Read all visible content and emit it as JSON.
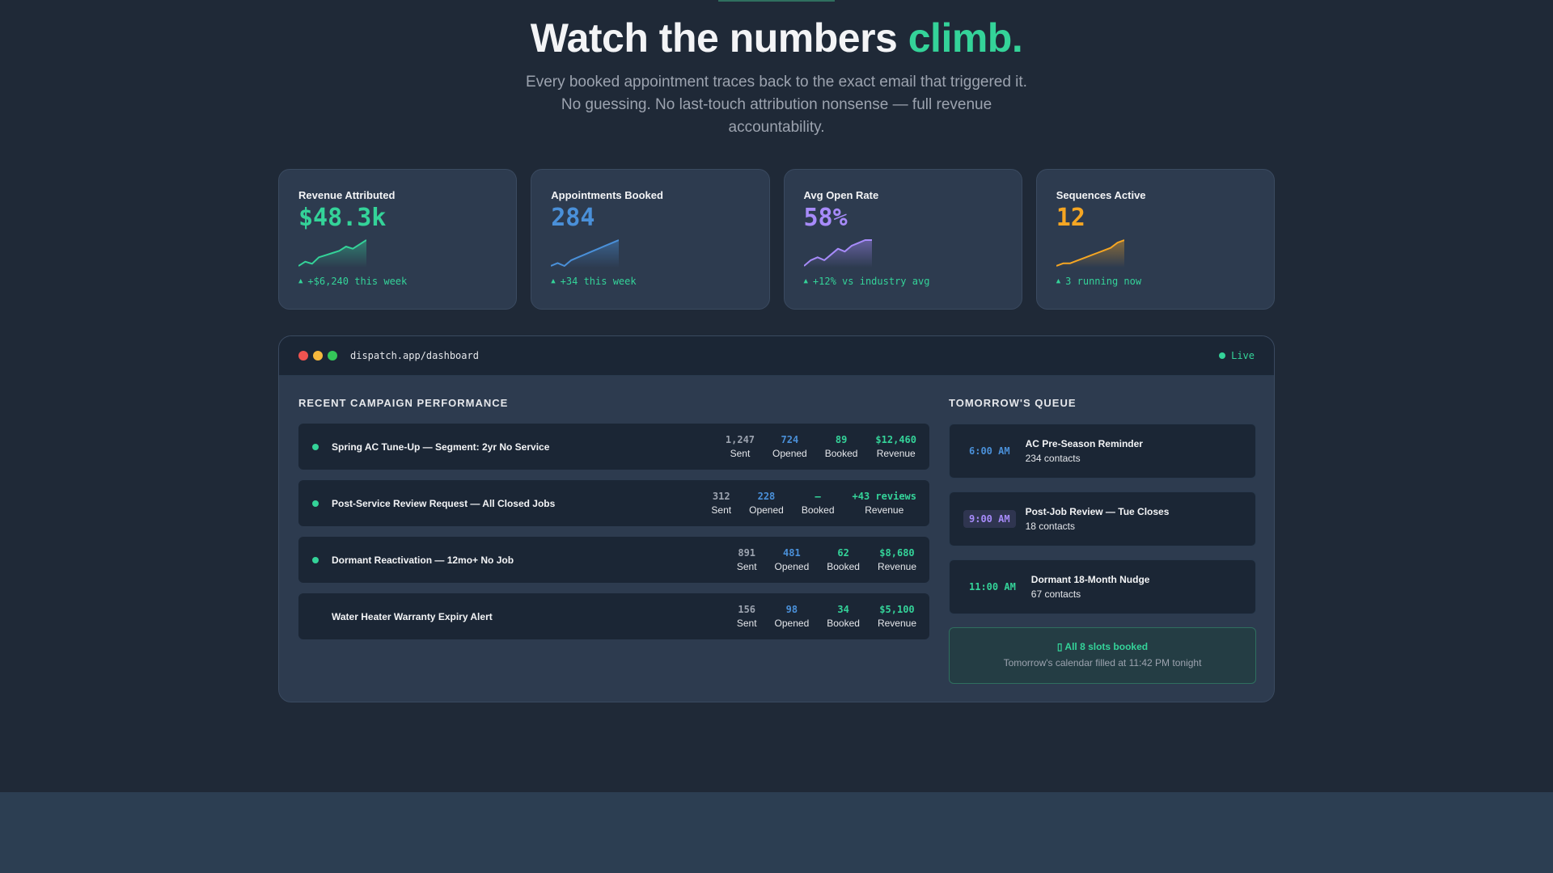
{
  "hero": {
    "title_main": "Watch the numbers ",
    "title_accent": "climb.",
    "subtitle": "Every booked appointment traces back to the exact email that triggered it. No guessing. No last-touch attribution nonsense — full revenue accountability."
  },
  "stats": [
    {
      "label": "Revenue Attributed",
      "value": "$48.3k",
      "trend": "+$6,240 this week",
      "color": "#34d399",
      "spark": [
        2,
        4,
        3,
        6,
        7,
        8,
        9,
        11,
        10,
        12,
        14
      ]
    },
    {
      "label": "Appointments Booked",
      "value": "284",
      "trend": "+34 this week",
      "color": "#4a90d9",
      "spark": [
        2,
        3,
        2,
        4,
        5,
        6,
        7,
        8,
        9,
        10,
        11
      ]
    },
    {
      "label": "Avg Open Rate",
      "value": "58%",
      "trend": "+12% vs industry avg",
      "color": "#a78bfa",
      "spark": [
        2,
        4,
        5,
        4,
        6,
        8,
        7,
        9,
        10,
        11,
        11
      ]
    },
    {
      "label": "Sequences Active",
      "value": "12",
      "trend": "3 running now",
      "color": "#f5a623",
      "spark": [
        2,
        3,
        3,
        4,
        5,
        6,
        7,
        8,
        9,
        11,
        12
      ]
    }
  ],
  "window": {
    "url": "dispatch.app/dashboard",
    "live_label": "Live"
  },
  "campaigns": {
    "title": "RECENT CAMPAIGN PERFORMANCE",
    "metric_labels": {
      "sent": "Sent",
      "opened": "Opened",
      "booked": "Booked",
      "revenue": "Revenue"
    },
    "rows": [
      {
        "name": "Spring AC Tune-Up — Segment: 2yr No Service",
        "active": true,
        "sent": "1,247",
        "opened": "724",
        "booked": "89",
        "revenue": "$12,460"
      },
      {
        "name": "Post-Service Review Request — All Closed Jobs",
        "active": true,
        "sent": "312",
        "opened": "228",
        "booked": "—",
        "revenue": "+43 reviews"
      },
      {
        "name": "Dormant Reactivation — 12mo+ No Job",
        "active": true,
        "sent": "891",
        "opened": "481",
        "booked": "62",
        "revenue": "$8,680"
      },
      {
        "name": "Water Heater Warranty Expiry Alert",
        "active": false,
        "sent": "156",
        "opened": "98",
        "booked": "34",
        "revenue": "$5,100"
      }
    ]
  },
  "queue": {
    "title": "TOMORROW'S QUEUE",
    "items": [
      {
        "time": "6:00 AM",
        "title": "AC Pre-Season Reminder",
        "sub": "234 contacts",
        "time_color": "#4a90d9",
        "time_bg": "transparent"
      },
      {
        "time": "9:00 AM",
        "title": "Post-Job Review — Tue Closes",
        "sub": "18 contacts",
        "time_color": "#a78bfa",
        "time_bg": "#2f3550"
      },
      {
        "time": "11:00 AM",
        "title": "Dormant 18-Month Nudge",
        "sub": "67 contacts",
        "time_color": "#34d399",
        "time_bg": "transparent"
      }
    ],
    "done_title": "▯ All 8 slots booked",
    "done_sub": "Tomorrow's calendar filled at 11:42 PM tonight"
  }
}
